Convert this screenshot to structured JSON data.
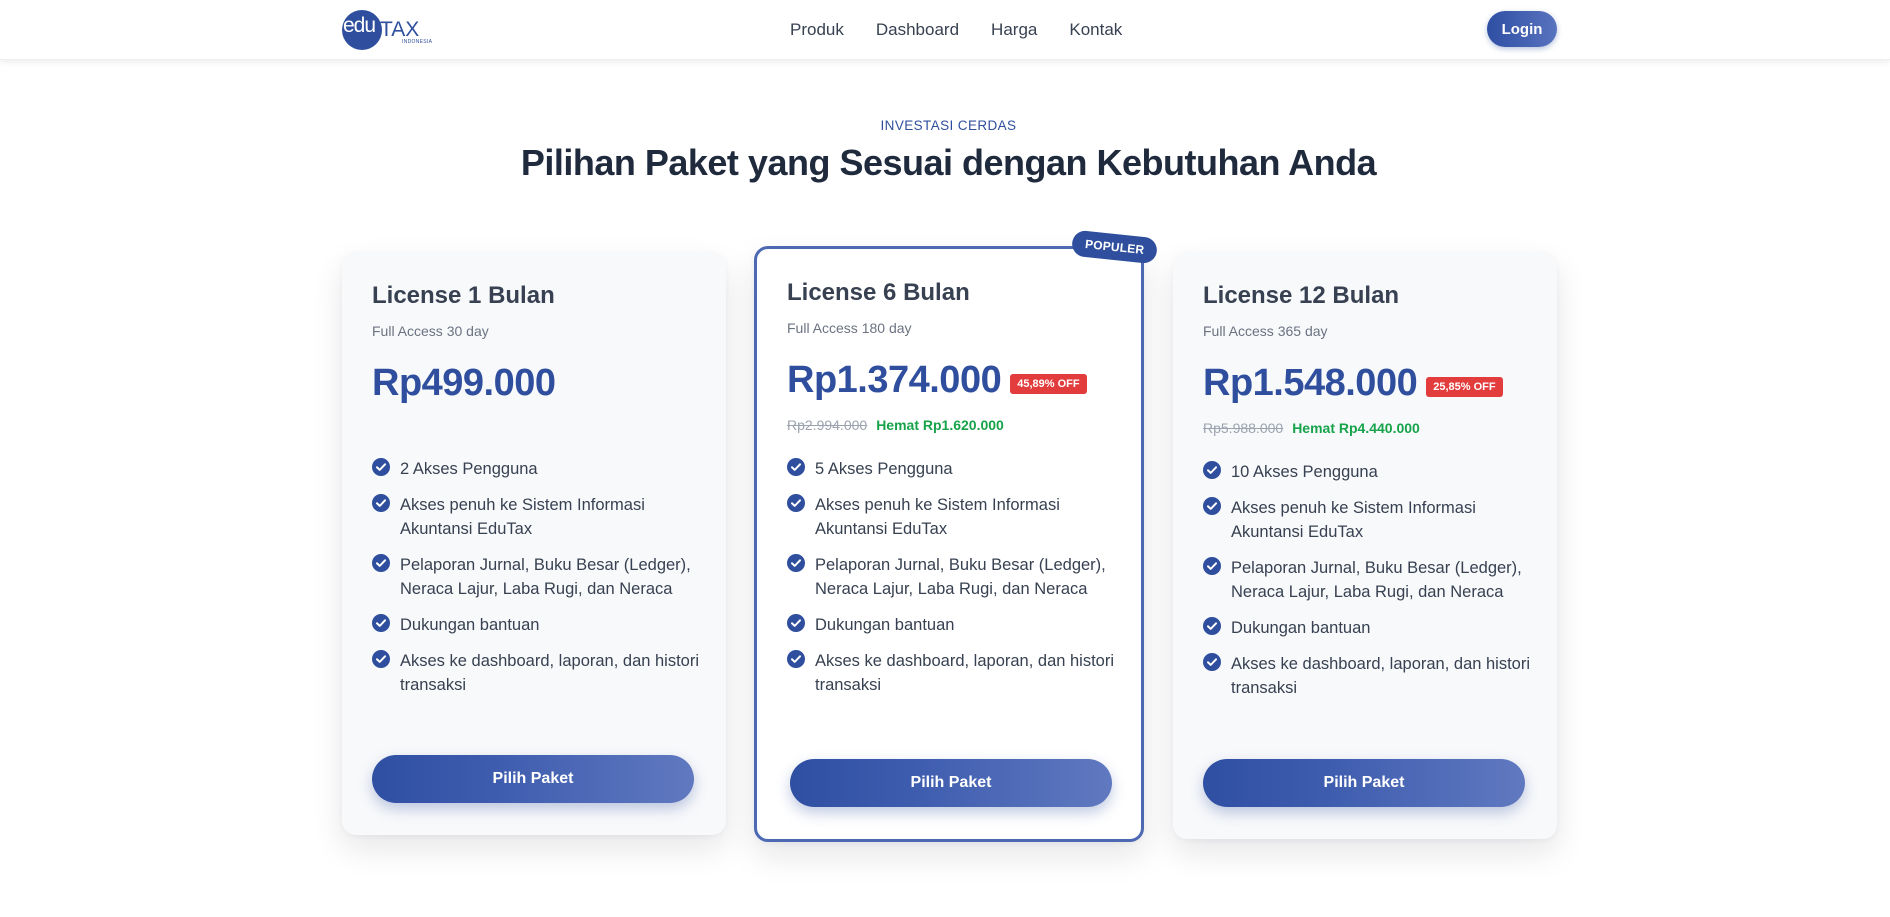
{
  "nav": {
    "logo": {
      "main": "edu",
      "brand": "TAX",
      "sub": "INDONESIA"
    },
    "links": [
      "Produk",
      "Dashboard",
      "Harga",
      "Kontak"
    ],
    "login_label": "Login"
  },
  "header": {
    "eyebrow": "INVESTASI CERDAS",
    "title": "Pilihan Paket yang Sesuai dengan Kebutuhan Anda"
  },
  "plans": [
    {
      "name": "License 1 Bulan",
      "subtitle": "Full Access 30 day",
      "price": "Rp499.000",
      "features": [
        "2 Akses Pengguna",
        "Akses penuh ke Sistem Informasi Akuntansi EduTax",
        "Pelaporan Jurnal, Buku Besar (Ledger), Neraca Lajur, Laba Rugi, dan Neraca",
        "Dukungan bantuan",
        "Akses ke dashboard, laporan, dan histori transaksi"
      ],
      "button_label": "Pilih Paket"
    },
    {
      "badge": "POPULER",
      "name": "License 6 Bulan",
      "subtitle": "Full Access 180 day",
      "price": "Rp1.374.000",
      "discount": "45,89% OFF",
      "old_price": "Rp2.994.000",
      "savings": "Hemat Rp1.620.000",
      "features": [
        "5 Akses Pengguna",
        "Akses penuh ke Sistem Informasi Akuntansi EduTax",
        "Pelaporan Jurnal, Buku Besar (Ledger), Neraca Lajur, Laba Rugi, dan Neraca",
        "Dukungan bantuan",
        "Akses ke dashboard, laporan, dan histori transaksi"
      ],
      "button_label": "Pilih Paket"
    },
    {
      "name": "License 12 Bulan",
      "subtitle": "Full Access 365 day",
      "price": "Rp1.548.000",
      "discount": "25,85% OFF",
      "old_price": "Rp5.988.000",
      "savings": "Hemat Rp4.440.000",
      "features": [
        "10 Akses Pengguna",
        "Akses penuh ke Sistem Informasi Akuntansi EduTax",
        "Pelaporan Jurnal, Buku Besar (Ledger), Neraca Lajur, Laba Rugi, dan Neraca",
        "Dukungan bantuan",
        "Akses ke dashboard, laporan, dan histori transaksi"
      ],
      "button_label": "Pilih Paket"
    }
  ],
  "colors": {
    "brand": "#2f4f9e",
    "discount": "#e23c3c",
    "savings": "#16a34a"
  },
  "icons": {
    "feature_check": "check-circle-icon"
  }
}
